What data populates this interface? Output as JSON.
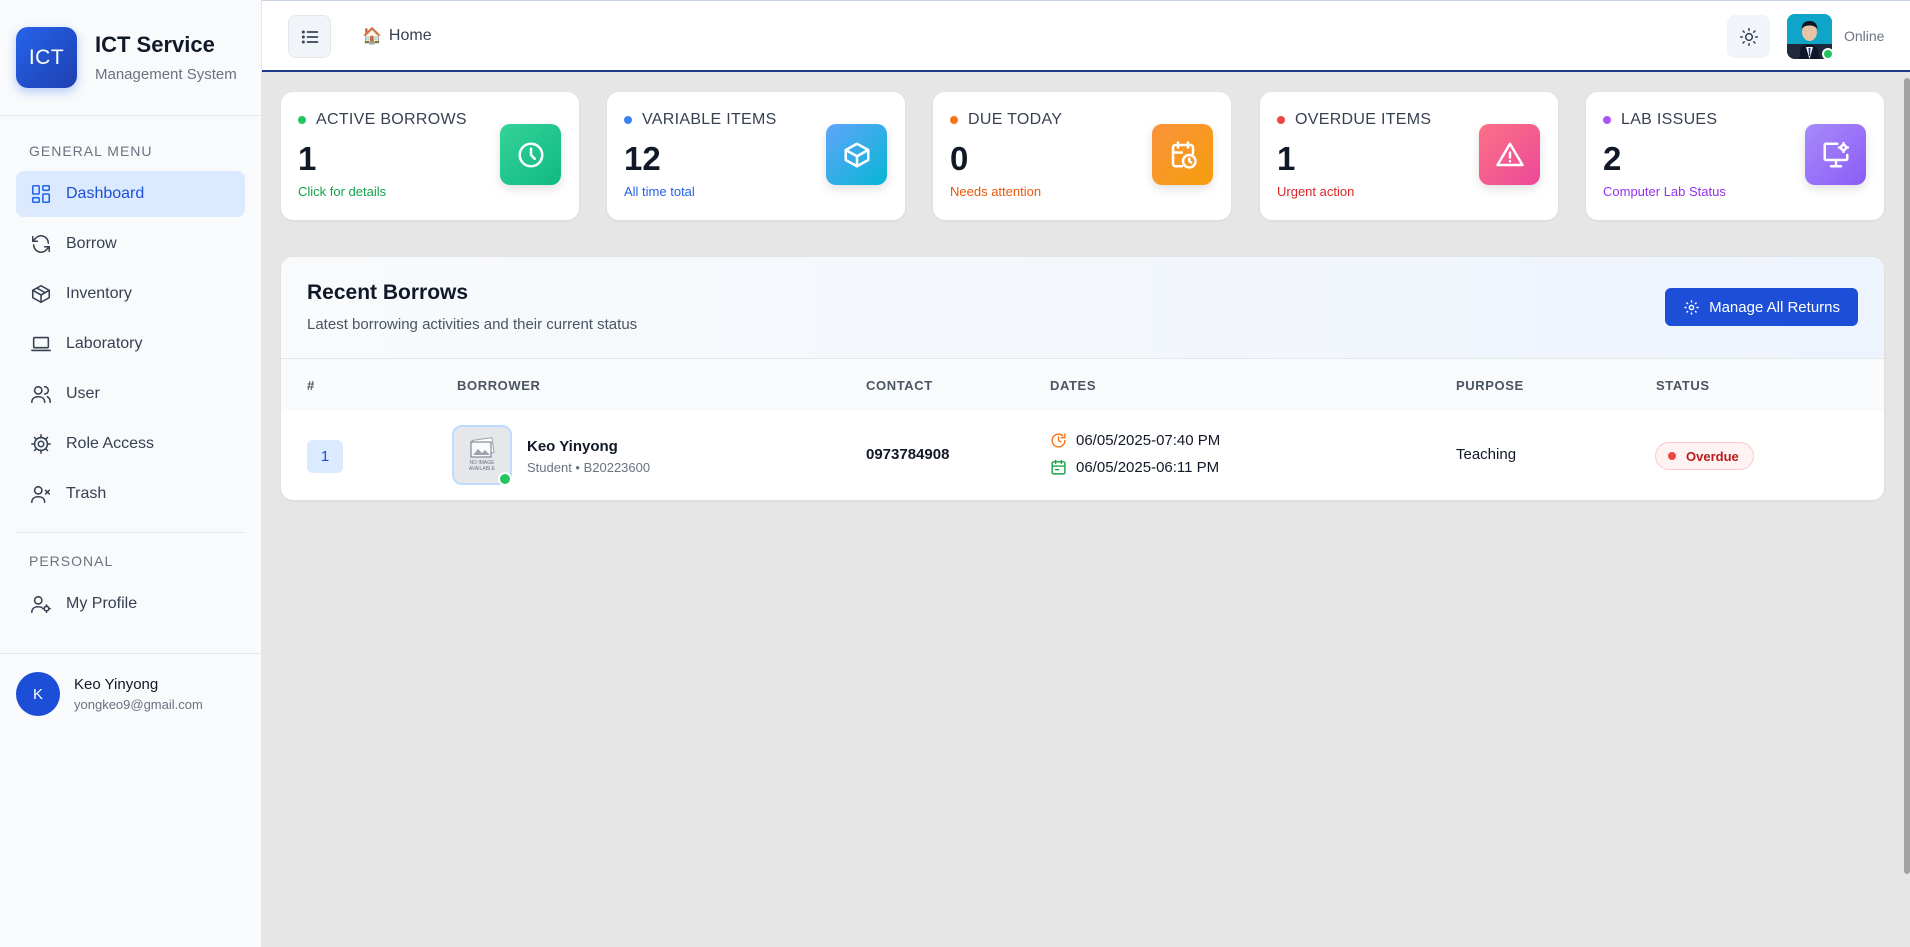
{
  "brand": {
    "logo": "ICT",
    "title": "ICT Service",
    "subtitle": "Management System"
  },
  "sidebar": {
    "general_heading": "GENERAL MENU",
    "items": [
      {
        "label": "Dashboard",
        "icon": "dashboard-icon",
        "active": true
      },
      {
        "label": "Borrow",
        "icon": "refresh-icon"
      },
      {
        "label": "Inventory",
        "icon": "box-icon"
      },
      {
        "label": "Laboratory",
        "icon": "laptop-icon"
      },
      {
        "label": "User",
        "icon": "users-icon"
      },
      {
        "label": "Role Access",
        "icon": "gear-icon"
      },
      {
        "label": "Trash",
        "icon": "user-x-icon"
      }
    ],
    "personal_heading": "PERSONAL",
    "personal_items": [
      {
        "label": "My Profile",
        "icon": "user-gear-icon"
      }
    ],
    "user": {
      "initial": "K",
      "name": "Keo Yinyong",
      "email": "yongkeo9@gmail.com"
    }
  },
  "header": {
    "breadcrumb": "Home",
    "home_icon": "🏠",
    "status": "Online"
  },
  "stats": [
    {
      "label": "ACTIVE BORROWS",
      "value": "1",
      "note": "Click for details",
      "dot": "#22c55e",
      "note_color": "#16a34a",
      "icon": "clock-icon",
      "gradient": [
        "#34d399",
        "#10b981"
      ]
    },
    {
      "label": "VARIABLE ITEMS",
      "value": "12",
      "note": "All time total",
      "dot": "#3b82f6",
      "note_color": "#2563eb",
      "icon": "cube-icon",
      "gradient": [
        "#60a5fa",
        "#06b6d4"
      ]
    },
    {
      "label": "DUE TODAY",
      "value": "0",
      "note": "Needs attention",
      "dot": "#f97316",
      "note_color": "#ea580c",
      "icon": "calendar-clock-icon",
      "gradient": [
        "#fb923c",
        "#f59e0b"
      ]
    },
    {
      "label": "OVERDUE ITEMS",
      "value": "1",
      "note": "Urgent action",
      "dot": "#ef4444",
      "note_color": "#dc2626",
      "icon": "warning-icon",
      "gradient": [
        "#fb7185",
        "#ec4899"
      ]
    },
    {
      "label": "LAB ISSUES",
      "value": "2",
      "note": "Computer Lab Status",
      "dot": "#a855f7",
      "note_color": "#9333ea",
      "icon": "monitor-gear-icon",
      "gradient": [
        "#a78bfa",
        "#8b5cf6"
      ]
    }
  ],
  "recent": {
    "title": "Recent Borrows",
    "subtitle": "Latest borrowing activities and their current status",
    "manage_label": "Manage All Returns",
    "columns": [
      "#",
      "BORROWER",
      "CONTACT",
      "DATES",
      "PURPOSE",
      "STATUS"
    ],
    "rows": [
      {
        "index": "1",
        "name": "Keo Yinyong",
        "meta": "Student • B20223600",
        "photo_text": [
          "NO IMAGE",
          "AVAILABLE"
        ],
        "contact": "0973784908",
        "borrow_date": "06/05/2025-07:40 PM",
        "return_date": "06/05/2025-06:11 PM",
        "purpose": "Teaching",
        "status": "Overdue"
      }
    ]
  }
}
